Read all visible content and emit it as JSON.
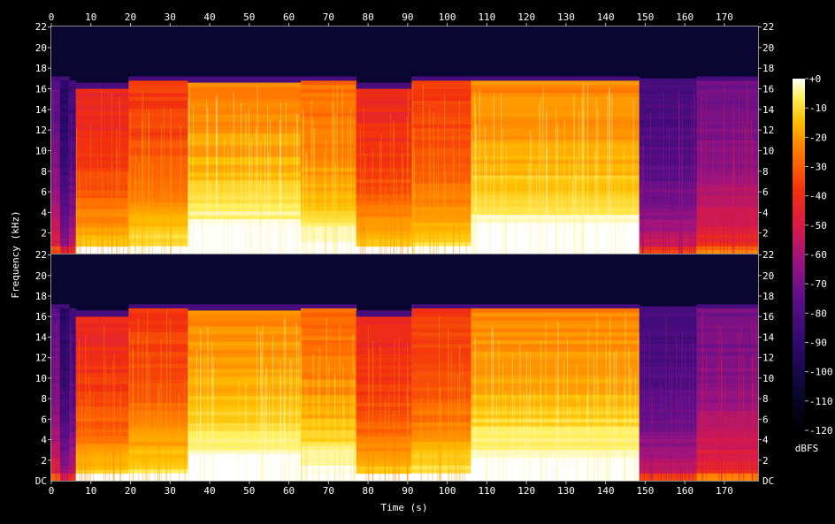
{
  "chart_data": {
    "type": "heatmap",
    "xlabel": "Time (s)",
    "ylabel": "Frequency (kHz)",
    "xlim": [
      0,
      178.5
    ],
    "x_ticks": [
      0,
      10,
      20,
      30,
      40,
      50,
      60,
      70,
      80,
      90,
      100,
      110,
      120,
      130,
      140,
      150,
      160,
      170
    ],
    "ylim": [
      0,
      22.05
    ],
    "y_ticks": [
      2,
      4,
      6,
      8,
      10,
      12,
      14,
      16,
      18,
      20,
      22
    ],
    "y_top_label": "22",
    "y_bottom_label": "DC",
    "channels": 2,
    "colorbar": {
      "label": "dBFS",
      "range": [
        -120,
        0
      ],
      "tick_values": [
        0,
        -10,
        -20,
        -30,
        -40,
        -50,
        -60,
        -70,
        -80,
        -90,
        -100,
        -110,
        -120
      ],
      "tick_labels": [
        "+0",
        "-10",
        "-20",
        "-30",
        "-40",
        "-50",
        "-60",
        "-70",
        "-80",
        "-90",
        "-100",
        "-110",
        "-120"
      ]
    },
    "segments": [
      {
        "t0": 0,
        "t1": 2.2,
        "cutoff_khz": 16.8,
        "level": 0.42
      },
      {
        "t0": 2.2,
        "t1": 4.5,
        "cutoff_khz": 16.8,
        "level": 0.28
      },
      {
        "t0": 4.5,
        "t1": 6.2,
        "cutoff_khz": 16.2,
        "level": 0.35
      },
      {
        "t0": 6.2,
        "t1": 19.5,
        "cutoff_khz": 16.0,
        "level": 0.7
      },
      {
        "t0": 19.5,
        "t1": 34.5,
        "cutoff_khz": 16.8,
        "level": 0.74
      },
      {
        "t0": 34.5,
        "t1": 63.0,
        "cutoff_khz": 16.6,
        "level": 0.86
      },
      {
        "t0": 63.0,
        "t1": 77.0,
        "cutoff_khz": 16.8,
        "level": 0.82
      },
      {
        "t0": 77.0,
        "t1": 91.0,
        "cutoff_khz": 16.0,
        "level": 0.7
      },
      {
        "t0": 91.0,
        "t1": 106.0,
        "cutoff_khz": 16.8,
        "level": 0.74
      },
      {
        "t0": 106.0,
        "t1": 148.5,
        "cutoff_khz": 16.8,
        "level": 0.86
      },
      {
        "t0": 148.5,
        "t1": 163.0,
        "cutoff_khz": 16.4,
        "level": 0.36
      },
      {
        "t0": 163.0,
        "t1": 178.5,
        "cutoff_khz": 16.8,
        "level": 0.46
      }
    ]
  }
}
